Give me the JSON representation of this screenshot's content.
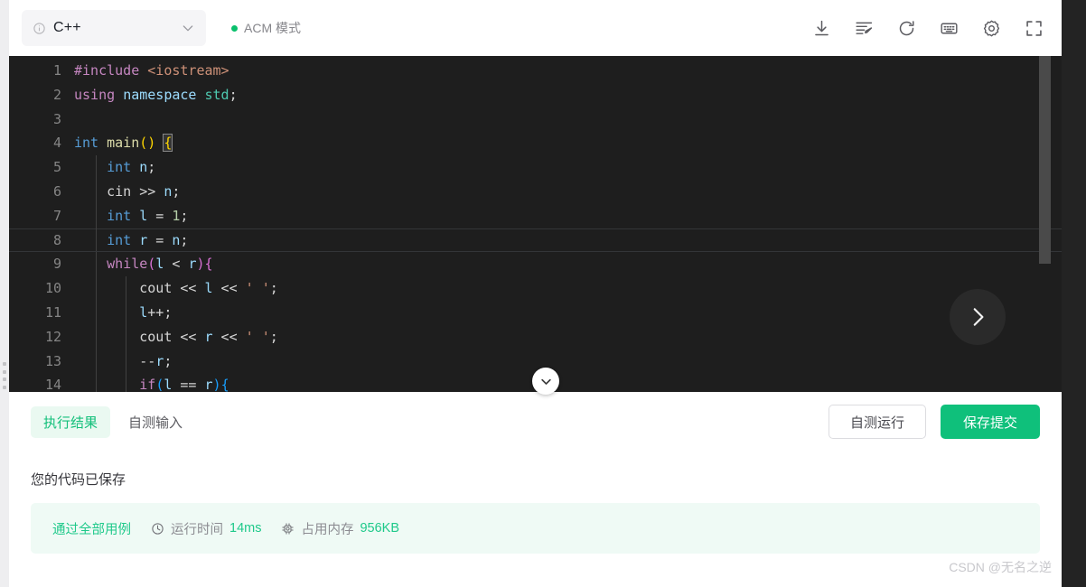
{
  "toolbar": {
    "language": "C++",
    "info_icon": "info-circle-icon",
    "chevron_icon": "chevron-down-icon",
    "mode_label": "ACM 模式",
    "icons": [
      {
        "name": "download-icon",
        "title": "下载"
      },
      {
        "name": "format-code-icon",
        "title": "格式化"
      },
      {
        "name": "reset-icon",
        "title": "重置"
      },
      {
        "name": "console-icon",
        "title": "控制台"
      },
      {
        "name": "settings-icon",
        "title": "设置"
      },
      {
        "name": "fullscreen-icon",
        "title": "全屏"
      }
    ]
  },
  "editor": {
    "language": "cpp",
    "active_line": 8,
    "lines": [
      {
        "n": "1",
        "code": "#include <iostream>"
      },
      {
        "n": "2",
        "code": "using namespace std;"
      },
      {
        "n": "3",
        "code": ""
      },
      {
        "n": "4",
        "code": "int main() {"
      },
      {
        "n": "5",
        "code": "    int n;"
      },
      {
        "n": "6",
        "code": "    cin >> n;"
      },
      {
        "n": "7",
        "code": "    int l = 1;"
      },
      {
        "n": "8",
        "code": "    int r = n;"
      },
      {
        "n": "9",
        "code": "    while(l < r){"
      },
      {
        "n": "10",
        "code": "        cout << l << ' ';"
      },
      {
        "n": "11",
        "code": "        l++;"
      },
      {
        "n": "12",
        "code": "        cout << r << ' ';"
      },
      {
        "n": "13",
        "code": "        --r;"
      },
      {
        "n": "14",
        "code": "        if(l == r){"
      }
    ],
    "next_button_icon": "chevron-right-icon",
    "collapse_button_icon": "chevron-down-icon"
  },
  "panel": {
    "tabs": [
      {
        "label": "执行结果",
        "active": true
      },
      {
        "label": "自测输入",
        "active": false
      }
    ],
    "buttons": {
      "self_test": "自测运行",
      "submit": "保存提交"
    },
    "saved_message": "您的代码已保存",
    "result": {
      "status": "通过全部用例",
      "time_icon": "clock-icon",
      "time_label": "运行时间",
      "time_value": "14ms",
      "memory_icon": "cpu-chip-icon",
      "memory_label": "占用内存",
      "memory_value": "956KB"
    }
  },
  "watermark": "CSDN @无名之逆",
  "colors": {
    "accent_green": "#0fc07b",
    "tab_active_bg": "#eaf9f1",
    "result_bg": "#effaf5",
    "editor_bg": "#1e1e1e",
    "rail_dark": "#232323"
  }
}
